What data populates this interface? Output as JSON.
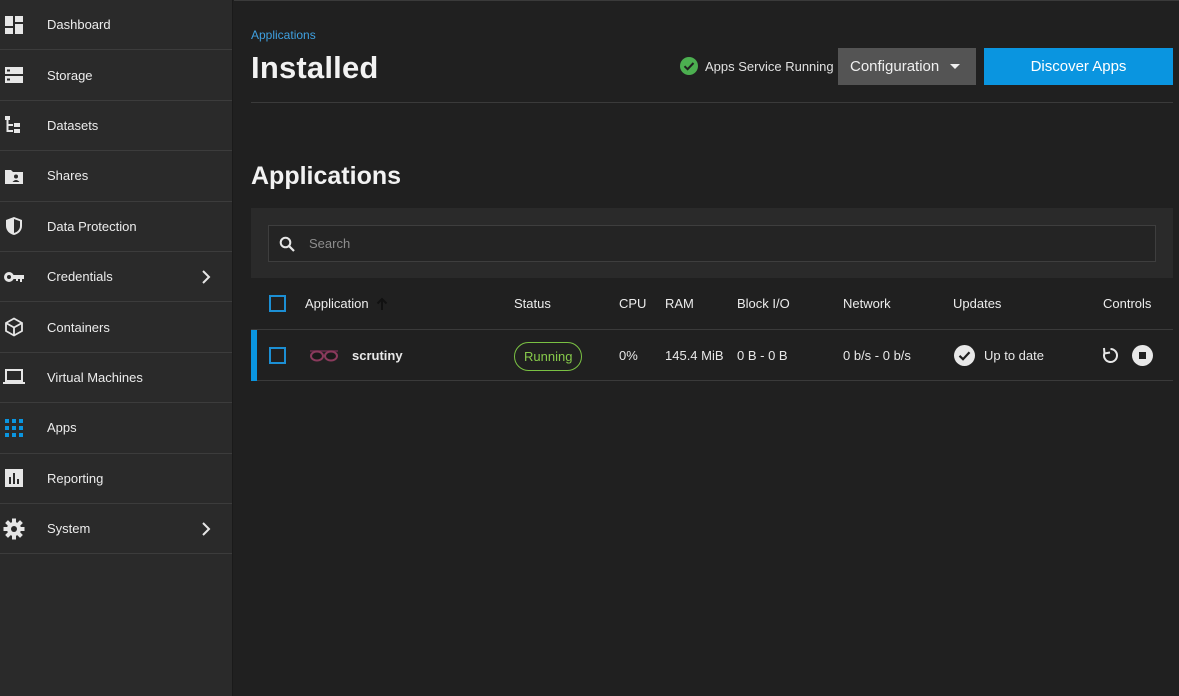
{
  "sidebar": {
    "items": [
      {
        "label": "Dashboard",
        "icon": "dashboard-icon"
      },
      {
        "label": "Storage",
        "icon": "storage-icon"
      },
      {
        "label": "Datasets",
        "icon": "datasets-icon"
      },
      {
        "label": "Shares",
        "icon": "shares-icon"
      },
      {
        "label": "Data Protection",
        "icon": "shield-icon"
      },
      {
        "label": "Credentials",
        "icon": "key-icon"
      },
      {
        "label": "Containers",
        "icon": "cube-icon"
      },
      {
        "label": "Virtual Machines",
        "icon": "laptop-icon"
      },
      {
        "label": "Apps",
        "icon": "apps-grid-icon"
      },
      {
        "label": "Reporting",
        "icon": "reporting-icon"
      },
      {
        "label": "System",
        "icon": "gear-icon"
      }
    ]
  },
  "header": {
    "breadcrumb": "Applications",
    "title": "Installed",
    "service_status": "Apps Service Running",
    "config_label": "Configuration",
    "discover_label": "Discover Apps"
  },
  "section": {
    "title": "Applications"
  },
  "search": {
    "placeholder": "Search",
    "value": ""
  },
  "table": {
    "columns": [
      "Application",
      "Status",
      "CPU",
      "RAM",
      "Block I/O",
      "Network",
      "Updates",
      "Controls"
    ],
    "rows": [
      {
        "name": "scrutiny",
        "status": "Running",
        "cpu": "0%",
        "ram": "145.4 MiB",
        "block_io": "0 B - 0 B",
        "network": "0 b/s - 0 b/s",
        "updates": "Up to date"
      }
    ]
  },
  "colors": {
    "accent": "#0a95e0",
    "running": "#86c94a",
    "success": "#4caf50"
  }
}
